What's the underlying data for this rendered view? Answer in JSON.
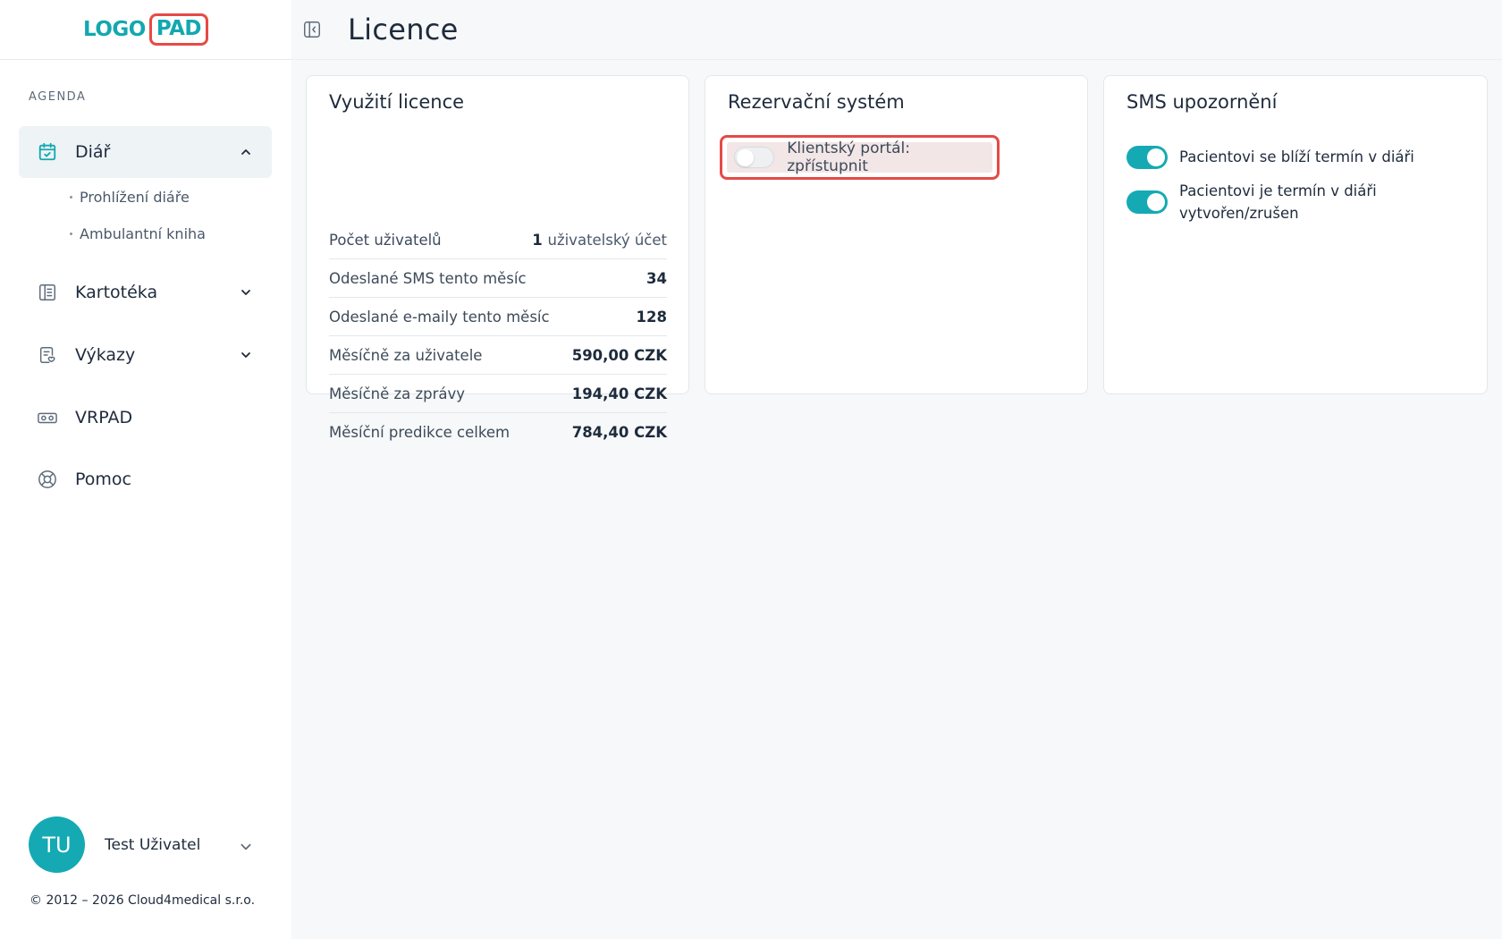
{
  "sidebar": {
    "logo": {
      "part1": "LOGO",
      "part2": "PAD"
    },
    "section_label": "AGENDA",
    "nav": {
      "diar": {
        "label": "Diář",
        "icon": "calendar-check-icon"
      },
      "sub_items": [
        "Prohlížení diáře",
        "Ambulantní kniha"
      ],
      "kartoteka": {
        "label": "Kartotéka",
        "icon": "book-icon"
      },
      "vykazy": {
        "label": "Výkazy",
        "icon": "report-icon"
      },
      "vrpad": {
        "label": "VRPAD",
        "icon": "vr-headset-icon"
      },
      "pomoc": {
        "label": "Pomoc",
        "icon": "lifebuoy-icon"
      }
    },
    "user": {
      "initials": "TU",
      "name": "Test Uživatel"
    },
    "copyright": "© 2012 – 2026 Cloud4medical s.r.o."
  },
  "header": {
    "title": "Licence"
  },
  "cards": {
    "license": {
      "title": "Využití licence",
      "rows": [
        {
          "label": "Počet uživatelů",
          "value_bold": "1",
          "value_light": "uživatelský účet"
        },
        {
          "label": "Odeslané SMS tento měsíc",
          "value_bold": "34",
          "value_light": ""
        },
        {
          "label": "Odeslané e-maily tento měsíc",
          "value_bold": "128",
          "value_light": ""
        },
        {
          "label": "Měsíčně za uživatele",
          "value_bold": "590,00 CZK",
          "value_light": ""
        },
        {
          "label": "Měsíčně za zprávy",
          "value_bold": "194,40 CZK",
          "value_light": ""
        },
        {
          "label": "Měsíční predikce celkem",
          "value_bold": "784,40 CZK",
          "value_light": ""
        }
      ]
    },
    "reservation": {
      "title": "Rezervační systém",
      "portal_label": "Klientský portál: zpřístupnit",
      "portal_enabled": false
    },
    "sms": {
      "title": "SMS upozornění",
      "items": [
        {
          "label": "Pacientovi se blíží termín v diáři",
          "enabled": true
        },
        {
          "label": "Pacientovi je termín v diáři vytvořen/zrušen",
          "enabled": true
        }
      ]
    }
  },
  "colors": {
    "accent": "#15aab3",
    "highlight": "#e64a46",
    "text": "#1e2b3c"
  }
}
